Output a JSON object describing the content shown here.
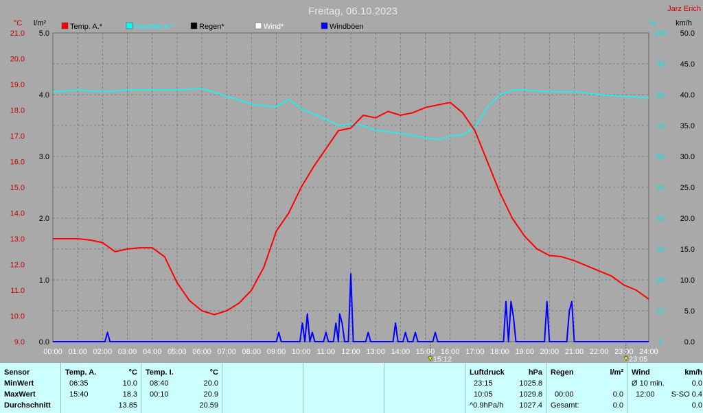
{
  "title": "Freitag, 06.10.2023",
  "author": "Jarz Erich",
  "unit_labels": {
    "temp": "°C",
    "rain": "l/m²",
    "humidity": "%",
    "wind": "km/h"
  },
  "legend": [
    {
      "label": "Temp. A.*",
      "color": "#ff0000"
    },
    {
      "label": "Feuchte A.*",
      "color": "#00ffff"
    },
    {
      "label": "Regen*",
      "color": "#000000"
    },
    {
      "label": "Wind*",
      "color": "#ffffff"
    },
    {
      "label": "Windböen",
      "color": "#0000ff"
    }
  ],
  "markers": [
    {
      "label": "15:12",
      "hour": 15.2
    },
    {
      "label": "23:05",
      "hour": 23.083
    }
  ],
  "chart_data": {
    "type": "line",
    "title": "Freitag, 06.10.2023",
    "xlim": [
      0,
      24
    ],
    "x_ticks": [
      "00:00",
      "01:00",
      "02:00",
      "03:00",
      "04:00",
      "05:00",
      "06:00",
      "07:00",
      "08:00",
      "09:00",
      "10:00",
      "11:00",
      "12:00",
      "13:00",
      "14:00",
      "15:00",
      "16:00",
      "17:00",
      "18:00",
      "19:00",
      "20:00",
      "21:00",
      "22:00",
      "23:00",
      "24:00"
    ],
    "axes": {
      "temp": {
        "unit": "°C",
        "lim": [
          9,
          21
        ],
        "ticks": [
          "9.0",
          "10.0",
          "11.0",
          "12.0",
          "13.0",
          "14.0",
          "15.0",
          "16.0",
          "17.0",
          "18.0",
          "19.0",
          "20.0",
          "21.0"
        ]
      },
      "rain": {
        "unit": "l/m²",
        "lim": [
          0,
          5
        ],
        "ticks": [
          "0.0",
          "1.0",
          "2.0",
          "3.0",
          "4.0",
          "5.0"
        ]
      },
      "humidity": {
        "unit": "%",
        "lim": [
          0,
          100
        ],
        "ticks": [
          "0",
          "10",
          "20",
          "30",
          "40",
          "50",
          "60",
          "70",
          "80",
          "90",
          "100"
        ]
      },
      "wind": {
        "unit": "km/h",
        "lim": [
          0,
          50
        ],
        "ticks": [
          "0.0",
          "5.0",
          "10.0",
          "15.0",
          "20.0",
          "25.0",
          "30.0",
          "35.0",
          "40.0",
          "45.0",
          "50.0"
        ]
      }
    },
    "grid": true,
    "series": [
      {
        "name": "Temp. A.*",
        "axis": "temp",
        "color": "#ff0000",
        "x": [
          0,
          0.5,
          1,
          1.5,
          2,
          2.5,
          3,
          3.5,
          4,
          4.5,
          5,
          5.5,
          6,
          6.5,
          7,
          7.5,
          8,
          8.5,
          9,
          9.5,
          10,
          10.5,
          11,
          11.5,
          12,
          12.5,
          13,
          13.5,
          14,
          14.5,
          15,
          15.5,
          16,
          16.5,
          17,
          17.5,
          18,
          18.5,
          19,
          19.5,
          20,
          20.5,
          21,
          21.5,
          22,
          22.5,
          23,
          23.5,
          24
        ],
        "y": [
          13.0,
          13.0,
          13.0,
          12.95,
          12.85,
          12.5,
          12.6,
          12.65,
          12.65,
          12.3,
          11.3,
          10.6,
          10.2,
          10.05,
          10.2,
          10.5,
          11.0,
          11.9,
          13.3,
          14.0,
          15.0,
          15.8,
          16.5,
          17.2,
          17.3,
          17.8,
          17.7,
          17.95,
          17.8,
          17.9,
          18.1,
          18.2,
          18.3,
          17.9,
          17.2,
          16.0,
          14.8,
          13.8,
          13.1,
          12.6,
          12.35,
          12.3,
          12.15,
          11.95,
          11.75,
          11.55,
          11.2,
          11.0,
          10.65
        ]
      },
      {
        "name": "Feuchte A.*",
        "axis": "humidity",
        "color": "#00ffff",
        "x": [
          0,
          1,
          2,
          3,
          4,
          5,
          6,
          7,
          8,
          9,
          9.5,
          10,
          11,
          11.5,
          12,
          12.5,
          13,
          14,
          15,
          15.5,
          16,
          16.5,
          17,
          17.5,
          18,
          18.5,
          19,
          20,
          21,
          22,
          23,
          24
        ],
        "y": [
          81,
          81.5,
          81,
          81.5,
          81.5,
          81.5,
          82,
          79.5,
          77,
          76,
          78.5,
          75.5,
          72,
          70,
          70.5,
          70,
          68.5,
          67.5,
          66,
          65.5,
          66.5,
          67,
          69.5,
          76,
          80,
          81.5,
          81.5,
          81,
          81,
          80,
          79.5,
          79
        ]
      },
      {
        "name": "Windböen",
        "axis": "wind",
        "color": "#0000ff",
        "x": [
          0,
          2.1,
          2.2,
          2.3,
          9,
          9.1,
          9.2,
          9.95,
          10.05,
          10.15,
          10.25,
          10.35,
          10.45,
          10.55,
          10.65,
          10.9,
          11.0,
          11.1,
          11.3,
          11.4,
          11.5,
          11.55,
          11.65,
          11.75,
          11.9,
          12.0,
          12.1,
          12.6,
          12.7,
          12.8,
          13.7,
          13.8,
          13.9,
          14.1,
          14.2,
          14.3,
          14.5,
          14.6,
          14.7,
          15.3,
          15.4,
          15.5,
          18.15,
          18.25,
          18.35,
          18.45,
          18.55,
          18.65,
          18.75,
          19.8,
          19.9,
          20.0,
          20.7,
          20.8,
          20.9,
          21.0,
          24
        ],
        "y": [
          0,
          0,
          1.5,
          0,
          0,
          1.5,
          0,
          0,
          3,
          0,
          4.5,
          0,
          1.5,
          0,
          0,
          0,
          1.5,
          0,
          0,
          3,
          0,
          4.5,
          3,
          0,
          0,
          11,
          0,
          0,
          1.5,
          0,
          0,
          3,
          0,
          0,
          1.5,
          0,
          0,
          1.5,
          0,
          0,
          1.5,
          0,
          0,
          6.5,
          0,
          6.5,
          4,
          0,
          0,
          0,
          6.5,
          0,
          0,
          5,
          6.5,
          0,
          0
        ]
      }
    ]
  },
  "footer": {
    "sensor": {
      "header": "Sensor",
      "rows": [
        "MinWert",
        "MaxWert",
        "Durchschnitt"
      ]
    },
    "temp_a": {
      "header": "Temp. A.",
      "unit": "°C",
      "rows": [
        [
          "06:35",
          "10.0"
        ],
        [
          "15:40",
          "18.3"
        ],
        [
          "",
          "13.85"
        ]
      ]
    },
    "temp_i": {
      "header": "Temp. I.",
      "unit": "°C",
      "rows": [
        [
          "08:40",
          "20.0"
        ],
        [
          "00:10",
          "20.9"
        ],
        [
          "",
          "20.59"
        ]
      ]
    },
    "pressure": {
      "header": "Luftdruck",
      "unit": "hPa",
      "rows": [
        [
          "23:15",
          "1025.8"
        ],
        [
          "10:05",
          "1029.8"
        ],
        [
          "^0.9hPa/h",
          "1027.4"
        ]
      ]
    },
    "rain": {
      "header": "Regen",
      "unit": "l/m²",
      "rows": [
        [
          "",
          ""
        ],
        [
          "00:00",
          "0.0"
        ],
        [
          "Gesamt:",
          "0.0"
        ]
      ]
    },
    "wind": {
      "header": "Wind",
      "unit": "km/h",
      "rows": [
        [
          "Ø 10 min.",
          "0.0"
        ],
        [
          "12:00",
          "S-SO 0.4"
        ],
        [
          "",
          "0.0"
        ]
      ]
    }
  }
}
